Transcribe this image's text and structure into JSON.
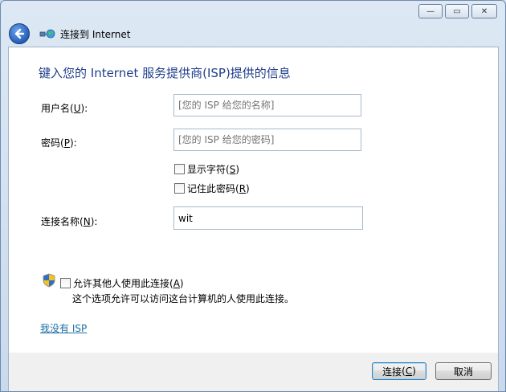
{
  "window": {
    "title": "连接到 Internet",
    "minimize_glyph": "—",
    "maximize_glyph": "▭",
    "close_glyph": "✕"
  },
  "form": {
    "heading": "键入您的 Internet 服务提供商(ISP)提供的信息",
    "username": {
      "label": "用户名",
      "accel": "U",
      "placeholder": "[您的 ISP 给您的名称]"
    },
    "password": {
      "label": "密码",
      "accel": "P",
      "placeholder": "[您的 ISP 给您的密码]"
    },
    "show_chars": {
      "label": "显示字符",
      "accel": "S",
      "checked": false
    },
    "remember": {
      "label": "记住此密码",
      "accel": "R",
      "checked": false
    },
    "conn_name": {
      "label": "连接名称",
      "accel": "N",
      "value": "wit"
    },
    "allow_others": {
      "label": "允许其他人使用此连接",
      "accel": "A",
      "checked": false,
      "description": "这个选项允许可以访问这台计算机的人使用此连接。"
    },
    "no_isp_link": "我没有 ISP"
  },
  "footer": {
    "connect": {
      "label": "连接",
      "accel": "C"
    },
    "cancel": {
      "label": "取消"
    }
  },
  "icons": [
    "back-arrow-icon",
    "network-globe-icon",
    "uac-shield-icon"
  ]
}
